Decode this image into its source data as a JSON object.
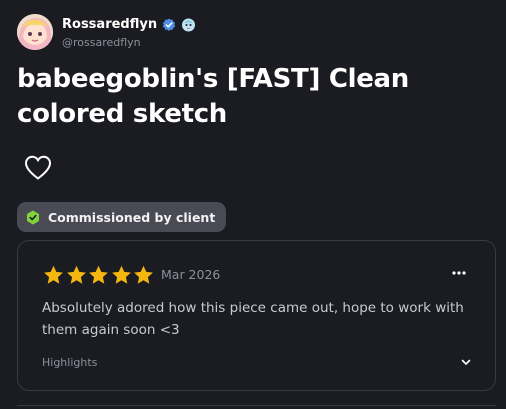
{
  "author": {
    "name": "Rossaredflyn",
    "handle": "@rossaredflyn",
    "verified": true,
    "badge_icon": "creature-badge-icon",
    "avatar_icon": "avatar-icon"
  },
  "listing": {
    "title": "babeegoblin's [FAST] Clean colored sketch",
    "favorite_icon": "heart-outline-icon",
    "commission_badge": {
      "label": "Commissioned by client",
      "icon": "check-hexagon-icon",
      "icon_color": "#7fd43c"
    }
  },
  "review": {
    "rating": 5,
    "max_rating": 5,
    "star_color": "#f5b60f",
    "date": "Mar 2026",
    "text": "Absolutely adored how this piece came out, hope to work with them again soon <3",
    "highlights_label": "Highlights",
    "more_icon": "more-horizontal-icon",
    "expand_icon": "chevron-down-icon"
  }
}
